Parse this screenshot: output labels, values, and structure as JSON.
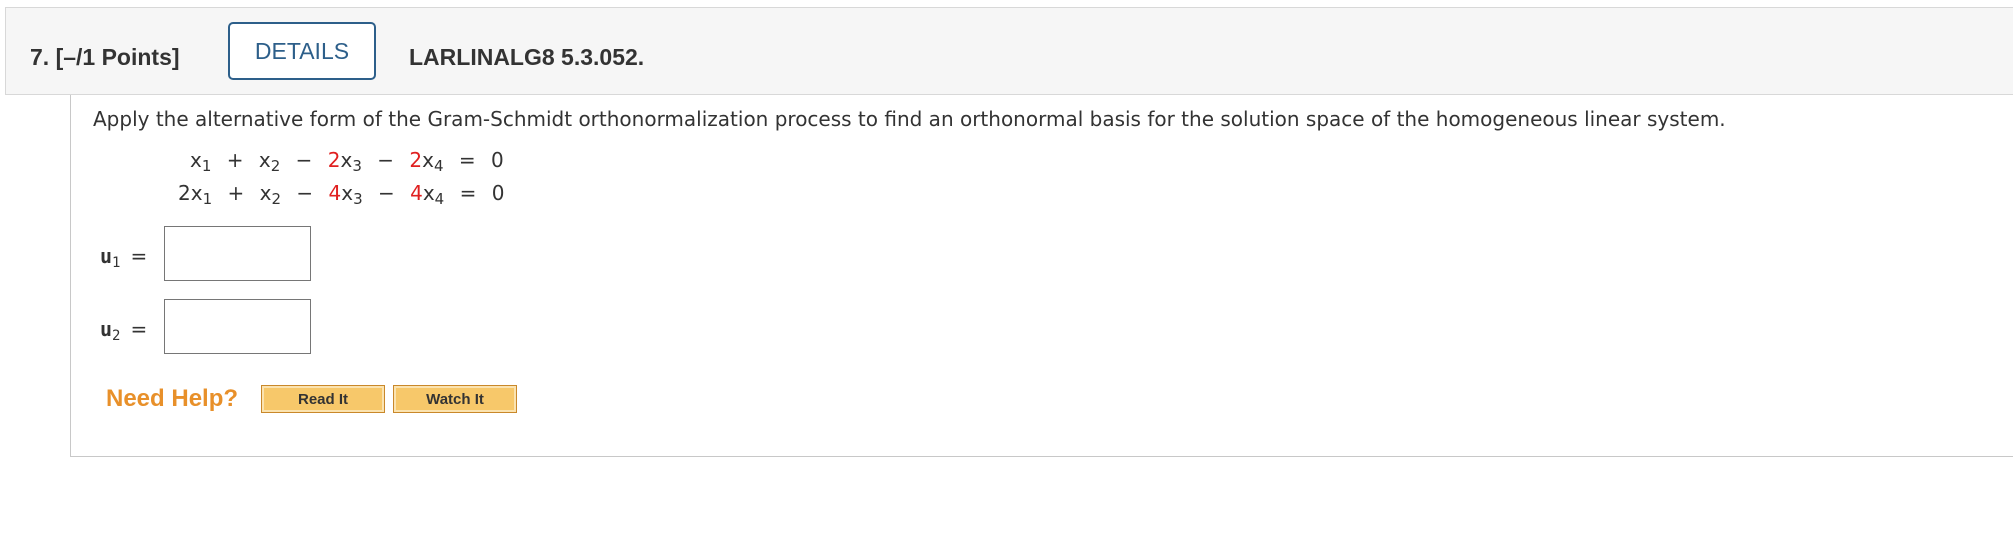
{
  "header": {
    "question_label": "7. [–/1 Points]",
    "details_button": "DETAILS",
    "question_code": "LARLINALG8 5.3.052."
  },
  "prompt": "Apply the alternative form of the Gram-Schmidt orthonormalization process to find an orthonormal basis for the solution space of the homogeneous linear system.",
  "system": {
    "row1": {
      "c1": "",
      "c2": "",
      "c3": "2",
      "c4": "2",
      "rhs": "0"
    },
    "row2": {
      "c1": "2",
      "c2": "",
      "c3": "4",
      "c4": "4",
      "rhs": "0"
    },
    "ops1": [
      "+",
      "−",
      "−",
      "="
    ],
    "ops2": [
      "+",
      "−",
      "−",
      "="
    ],
    "var": "x",
    "sub1": "1",
    "sub2": "2",
    "sub3": "3",
    "sub4": "4"
  },
  "answers": [
    {
      "label": "u",
      "sub": "1",
      "equals": "=",
      "value": ""
    },
    {
      "label": "u",
      "sub": "2",
      "equals": "=",
      "value": ""
    }
  ],
  "help": {
    "label": "Need Help?",
    "read_it": "Read It",
    "watch_it": "Watch It"
  },
  "colors": {
    "accent": "#2d5f8a",
    "highlight": "#e02020",
    "help_text": "#e8902a",
    "help_button": "#f7c86a"
  }
}
